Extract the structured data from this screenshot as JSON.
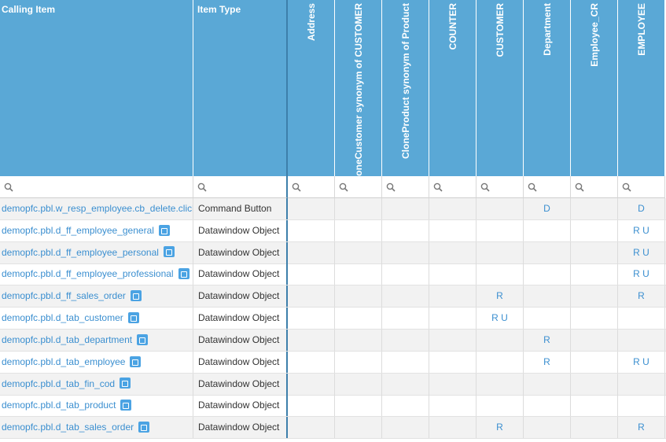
{
  "columns": {
    "calling_item": "Calling Item",
    "item_type": "Item Type",
    "tables": [
      "Address",
      "CloneCustomer synonym of CUSTOMER",
      "CloneProduct synonym of Product",
      "COUNTER",
      "CUSTOMER",
      "Department",
      "Employee_CR",
      "EMPLOYEE"
    ]
  },
  "filter": {
    "icon": "search-icon"
  },
  "rows": [
    {
      "item": "demopfc.pbl.w_resp_employee.cb_delete.click",
      "type": "Command Button",
      "icon": false,
      "perms": [
        "",
        "",
        "",
        "",
        "",
        "D",
        "",
        "D"
      ]
    },
    {
      "item": "demopfc.pbl.d_ff_employee_general",
      "type": "Datawindow Object",
      "icon": true,
      "perms": [
        "",
        "",
        "",
        "",
        "",
        "",
        "",
        "R U"
      ]
    },
    {
      "item": "demopfc.pbl.d_ff_employee_personal",
      "type": "Datawindow Object",
      "icon": true,
      "perms": [
        "",
        "",
        "",
        "",
        "",
        "",
        "",
        "R U"
      ]
    },
    {
      "item": "demopfc.pbl.d_ff_employee_professional",
      "type": "Datawindow Object",
      "icon": true,
      "perms": [
        "",
        "",
        "",
        "",
        "",
        "",
        "",
        "R U"
      ]
    },
    {
      "item": "demopfc.pbl.d_ff_sales_order",
      "type": "Datawindow Object",
      "icon": true,
      "perms": [
        "",
        "",
        "",
        "",
        "R",
        "",
        "",
        "R"
      ]
    },
    {
      "item": "demopfc.pbl.d_tab_customer",
      "type": "Datawindow Object",
      "icon": true,
      "perms": [
        "",
        "",
        "",
        "",
        "R U",
        "",
        "",
        ""
      ]
    },
    {
      "item": "demopfc.pbl.d_tab_department",
      "type": "Datawindow Object",
      "icon": true,
      "perms": [
        "",
        "",
        "",
        "",
        "",
        "R",
        "",
        ""
      ]
    },
    {
      "item": "demopfc.pbl.d_tab_employee",
      "type": "Datawindow Object",
      "icon": true,
      "perms": [
        "",
        "",
        "",
        "",
        "",
        "R",
        "",
        "R U"
      ]
    },
    {
      "item": "demopfc.pbl.d_tab_fin_cod",
      "type": "Datawindow Object",
      "icon": true,
      "perms": [
        "",
        "",
        "",
        "",
        "",
        "",
        "",
        ""
      ]
    },
    {
      "item": "demopfc.pbl.d_tab_product",
      "type": "Datawindow Object",
      "icon": true,
      "perms": [
        "",
        "",
        "",
        "",
        "",
        "",
        "",
        ""
      ]
    },
    {
      "item": "demopfc.pbl.d_tab_sales_order",
      "type": "Datawindow Object",
      "icon": true,
      "perms": [
        "",
        "",
        "",
        "",
        "R",
        "",
        "",
        "R"
      ]
    }
  ],
  "colors": {
    "header_bg": "#5aa8d6",
    "link": "#3b8fd0",
    "alt_row": "#f2f2f2"
  }
}
